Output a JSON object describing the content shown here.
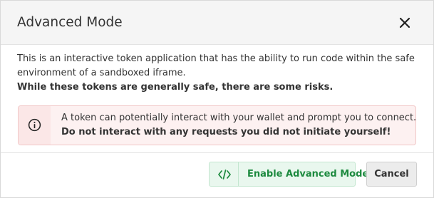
{
  "dialog": {
    "title": "Advanced Mode",
    "close_icon": "close-icon",
    "body": {
      "line1": "This is an interactive token application that has the ability to run code within the safe",
      "line2": "environment of a sandboxed iframe.",
      "line3": "While these tokens are generally safe, there are some risks."
    },
    "alert": {
      "icon": "info-icon",
      "line1": "A token can potentially interact with your wallet and prompt you to connect.",
      "line2": "Do not interact with any requests you did not initiate yourself!",
      "colors": {
        "border": "#f1c7c7",
        "background": "#fdf1f1"
      }
    },
    "footer": {
      "advanced_button": {
        "icon": "code-icon",
        "label": "Enable Advanced Mode",
        "color": "#1d8a3f"
      },
      "cancel_button": {
        "label": "Cancel"
      }
    }
  }
}
